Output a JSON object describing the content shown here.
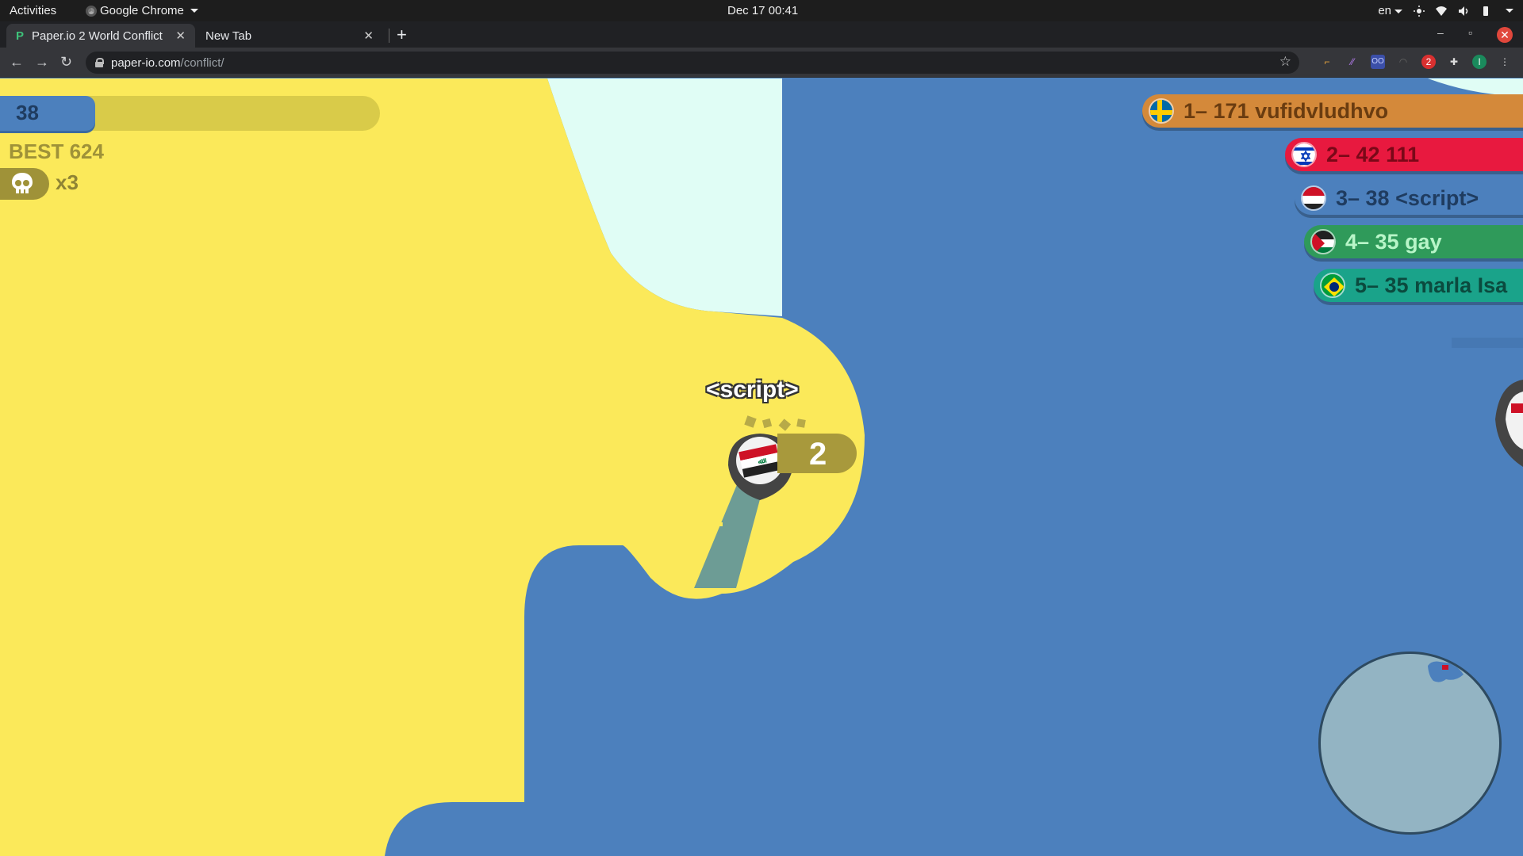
{
  "os_bar": {
    "activities": "Activities",
    "app_name": "Google Chrome",
    "clock": "Dec 17  00:41",
    "language": "en"
  },
  "browser": {
    "tabs": [
      {
        "title": "Paper.io 2 World Conflict",
        "active": true
      },
      {
        "title": "New Tab",
        "active": false
      }
    ],
    "url_host": "paper-io.com",
    "url_path": "/conflict/",
    "extension_badge": "2"
  },
  "game": {
    "score": "38",
    "best": "BEST 624",
    "kills": "x3",
    "player": {
      "name": "<script>",
      "kills": "2",
      "flag": "iraq"
    },
    "leaderboard": [
      {
        "text": "1– 171 vufidvludhvo",
        "bg": "#d4893a",
        "fg": "#6a3c10",
        "flag": "sweden"
      },
      {
        "text": "2– 42 111",
        "bg": "#e8193f",
        "fg": "#7a0818",
        "flag": "israel"
      },
      {
        "text": "3– 38 <script>",
        "bg": "#4c80bd",
        "fg": "#1f3c60",
        "flag": "iraq"
      },
      {
        "text": "4– 35 gay",
        "bg": "#2f9a5a",
        "fg": "#b8f5c8",
        "flag": "jordan"
      },
      {
        "text": "5– 35 marla  Isa",
        "bg": "#1aa38a",
        "fg": "#0b4a3e",
        "flag": "brazil"
      }
    ],
    "colors": {
      "player_territory": "#4c80bd",
      "enemy_yellow": "#fbe95a",
      "enemy_cyan": "#e0fdf5",
      "trail": "#6d9c95"
    }
  }
}
